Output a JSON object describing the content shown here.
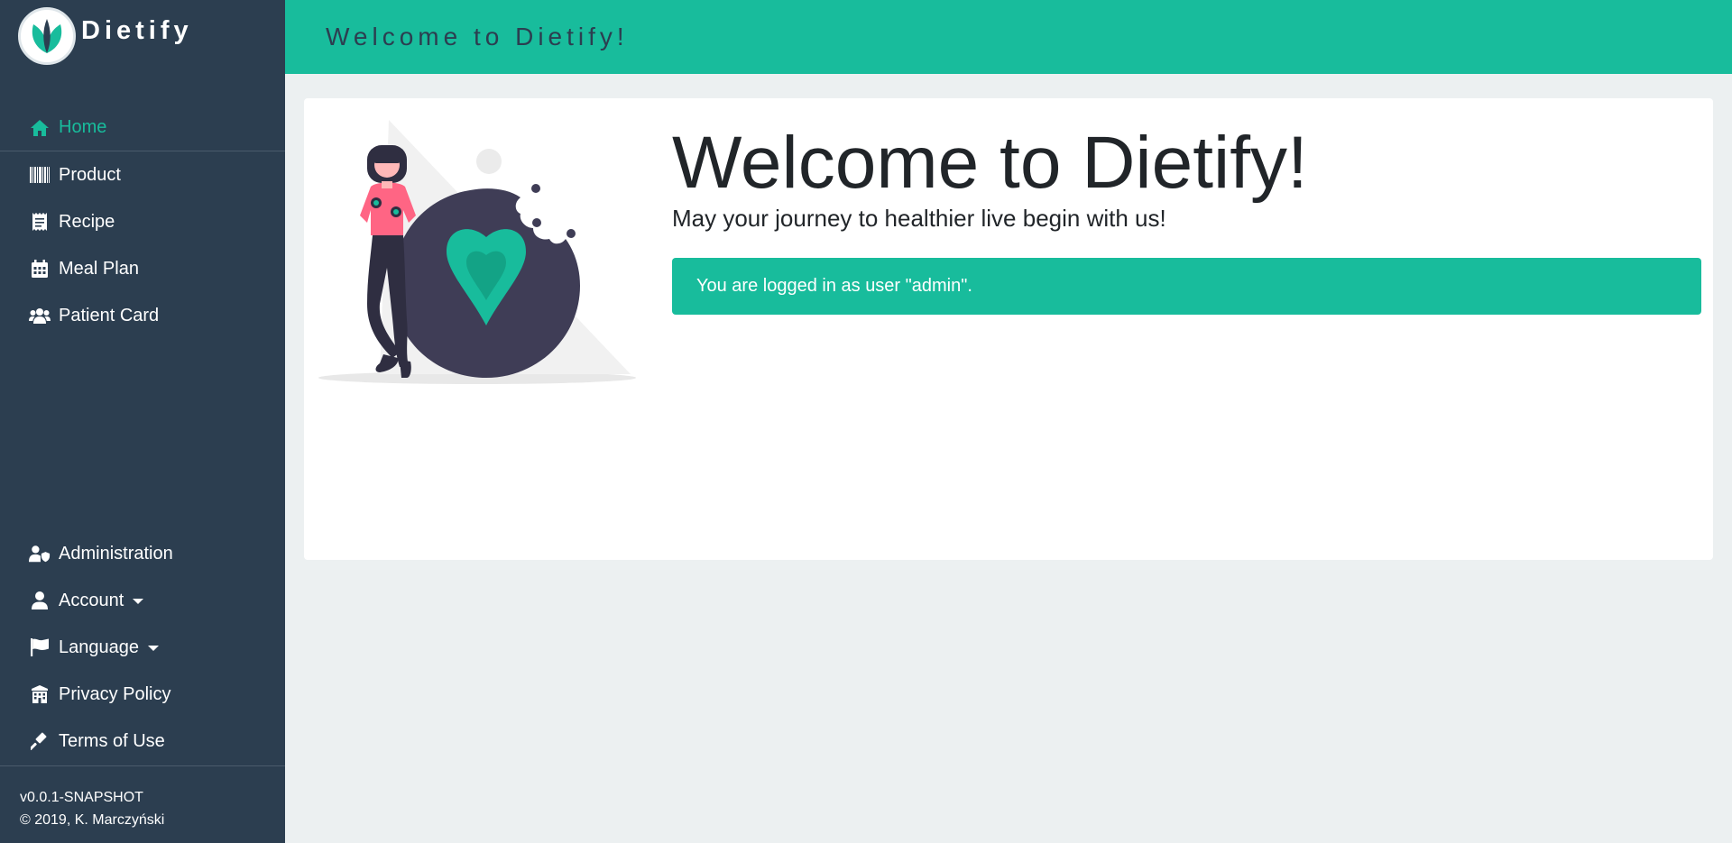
{
  "brand": {
    "name": "Dietify"
  },
  "header": {
    "title": "Welcome to Dietify!"
  },
  "sidebar": {
    "top_items": [
      {
        "label": "Home",
        "icon": "home-icon",
        "active": true
      },
      {
        "label": "Product",
        "icon": "barcode-icon"
      },
      {
        "label": "Recipe",
        "icon": "receipt-icon"
      },
      {
        "label": "Meal Plan",
        "icon": "calendar-icon"
      },
      {
        "label": "Patient Card",
        "icon": "users-icon"
      }
    ],
    "bottom_items": [
      {
        "label": "Administration",
        "icon": "user-shield-icon"
      },
      {
        "label": "Account",
        "icon": "user-icon",
        "dropdown": true
      },
      {
        "label": "Language",
        "icon": "flag-icon",
        "dropdown": true
      },
      {
        "label": "Privacy Policy",
        "icon": "building-icon"
      },
      {
        "label": "Terms of Use",
        "icon": "gavel-icon"
      }
    ],
    "footer": {
      "version": "v0.0.1-SNAPSHOT",
      "copyright": "© 2019, K. Marczyński"
    }
  },
  "main": {
    "title": "Welcome to Dietify!",
    "subtitle": "May your journey to healthier live begin with us!",
    "alert": "You are logged in as user \"admin\"."
  },
  "colors": {
    "accent": "#18bc9c",
    "sidebar": "#2c3e50",
    "background": "#ecf0f1"
  }
}
